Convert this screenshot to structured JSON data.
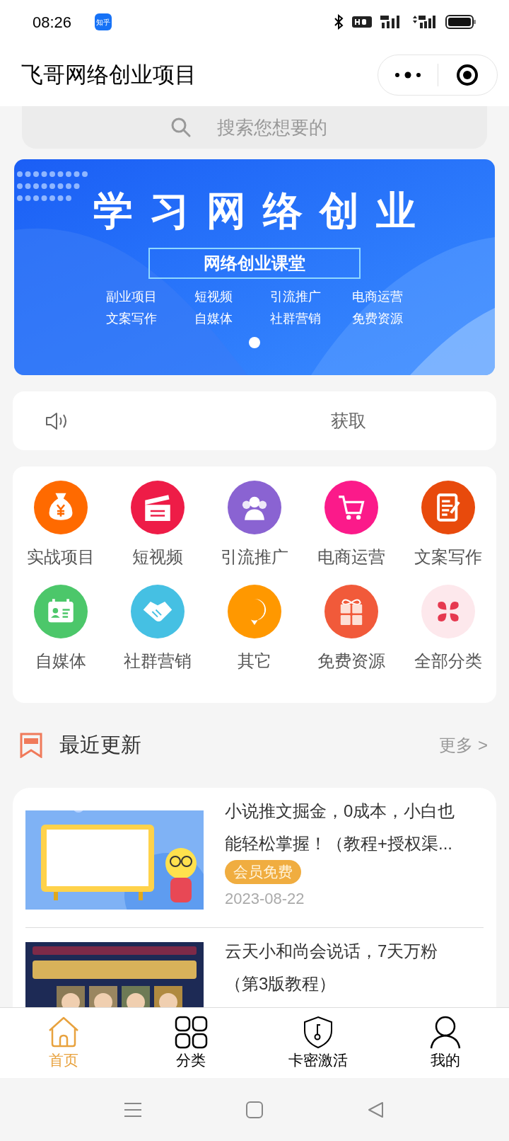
{
  "status_bar": {
    "time": "08:26",
    "app_badge": "知乎"
  },
  "header": {
    "title": "飞哥网络创业项目"
  },
  "search": {
    "placeholder": "搜索您想要的"
  },
  "banner": {
    "title": "学习网络创业",
    "subtitle": "网络创业课堂",
    "tags": [
      "副业项目",
      "短视频",
      "引流推广",
      "电商运营",
      "文案写作",
      "自媒体",
      "社群营销",
      "免费资源"
    ],
    "indicators": [
      {
        "selected": true
      }
    ]
  },
  "notice": {
    "text": "获取"
  },
  "categories": [
    {
      "label": "实战项目",
      "color": "#ff6a00"
    },
    {
      "label": "短视频",
      "color": "#ee1c47"
    },
    {
      "label": "引流推广",
      "color": "#8a63d2"
    },
    {
      "label": "电商运营",
      "color": "#fb1a8a"
    },
    {
      "label": "文案写作",
      "color": "#e84a0c"
    },
    {
      "label": "自媒体",
      "color": "#4cc76a"
    },
    {
      "label": "社群营销",
      "color": "#45c0e3"
    },
    {
      "label": "其它",
      "color": "#ff9800"
    },
    {
      "label": "免费资源",
      "color": "#f15a3a"
    },
    {
      "label": "全部分类",
      "color": "#fde8ec"
    }
  ],
  "section": {
    "title": "最近更新",
    "more": "更多 >"
  },
  "posts": [
    {
      "title": "小说推文掘金，0成本，小白也能轻松掌握！（教程+授权渠...",
      "tag": "会员免费",
      "date": "2023-08-22"
    },
    {
      "title": "云天小和尚会说话，7天万粉（第3版教程）"
    }
  ],
  "tab_bar": [
    {
      "label": "首页",
      "selected": true
    },
    {
      "label": "分类",
      "selected": false
    },
    {
      "label": "卡密激活",
      "selected": false
    },
    {
      "label": "我的",
      "selected": false
    }
  ]
}
